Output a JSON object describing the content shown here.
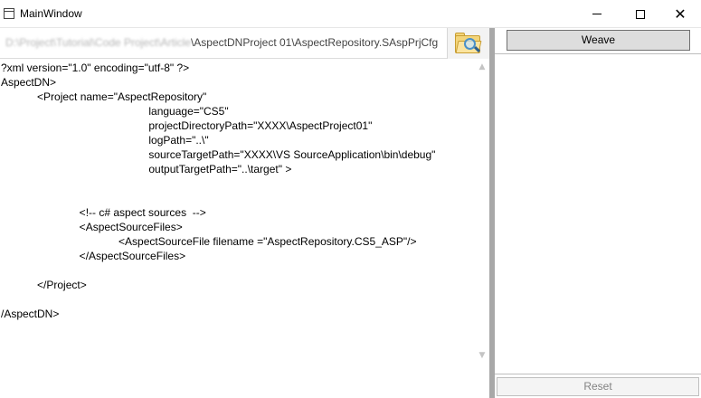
{
  "window": {
    "title": "MainWindow"
  },
  "path_bar": {
    "blurred_prefix": "D:\\Project\\Tutorial\\Code Project\\Article",
    "visible_path": "\\AspectDNProject 01\\AspectRepository.SAspPrjCfg"
  },
  "editor": {
    "lines": [
      "?xml version=\"1.0\" encoding=\"utf-8\" ?>",
      "AspectDN>",
      "            <Project name=\"AspectRepository\"",
      "                                                 language=\"CS5\"",
      "                                                 projectDirectoryPath=\"XXXX\\AspectProject01\"",
      "                                                 logPath=\"..\\\"",
      "                                                 sourceTargetPath=\"XXXX\\VS SourceApplication\\bin\\debug\"",
      "                                                 outputTargetPath=\"..\\target\" >",
      "",
      "",
      "                          <!-- c# aspect sources  -->",
      "                          <AspectSourceFiles>",
      "                                       <AspectSourceFile filename =\"AspectRepository.CS5_ASP\"/>",
      "                          </AspectSourceFiles>",
      "",
      "            </Project>",
      "",
      "/AspectDN>"
    ]
  },
  "right_pane": {
    "weave_label": "Weave",
    "reset_label": "Reset"
  },
  "icons": {
    "window_minimize": "minimize-icon",
    "window_maximize": "maximize-icon",
    "window_close": "close-icon",
    "browse": "folder-search-icon",
    "close_glyph": "✕"
  }
}
